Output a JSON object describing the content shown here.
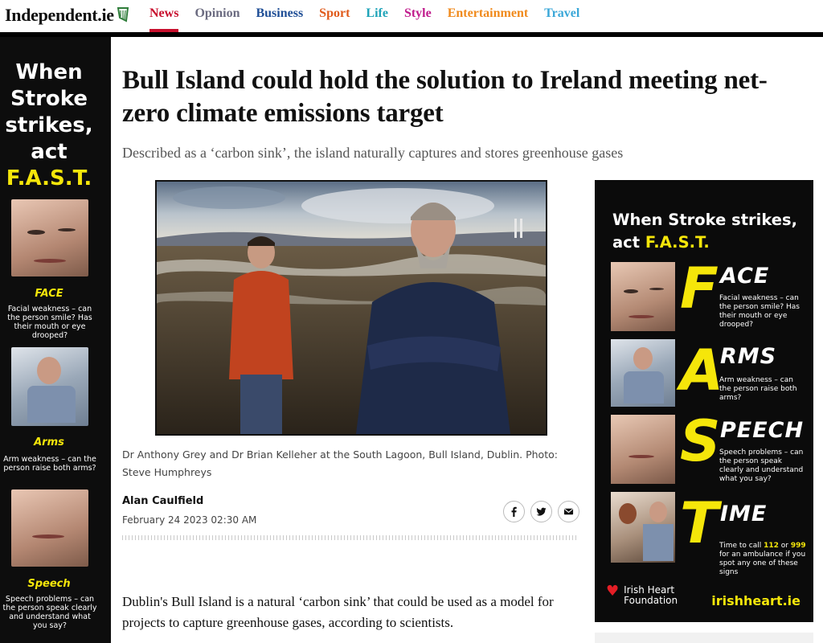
{
  "header": {
    "logo": "Independent.ie",
    "nav": [
      {
        "label": "News",
        "color": "#c8102e",
        "active": true
      },
      {
        "label": "Opinion",
        "color": "#6b6b80"
      },
      {
        "label": "Business",
        "color": "#1f4e96"
      },
      {
        "label": "Sport",
        "color": "#e05a1a"
      },
      {
        "label": "Life",
        "color": "#1ea3b8"
      },
      {
        "label": "Style",
        "color": "#c01a8c"
      },
      {
        "label": "Entertainment",
        "color": "#f08a1c"
      },
      {
        "label": "Travel",
        "color": "#3aa7d8"
      }
    ]
  },
  "left_ad": {
    "headline_white": "When Stroke strikes, act",
    "headline_yellow": "F.A.S.T.",
    "face_title": "FACE",
    "face_text": "Facial weakness – can the person smile? Has their mouth or eye drooped?",
    "arms_title": "Arms",
    "arms_text": "Arm weakness – can the person raise both arms?",
    "speech_title": "Speech",
    "speech_text": "Speech problems – can the person speak clearly and understand what you say?"
  },
  "article": {
    "headline": "Bull Island could hold the solution to Ireland meeting net-zero climate emissions target",
    "standfirst": "Described as a ‘carbon sink’, the island naturally captures and stores greenhouse gases",
    "caption": "Dr Anthony Grey and Dr Brian Kelleher at the South Lagoon, Bull Island, Dublin. Photo: Steve Humphreys",
    "author": "Alan Caulfield",
    "date": "February 24 2023 02:30 AM",
    "body_first_paragraph": "Dublin's Bull Island is a natural ‘carbon sink’ that could be used as a model for projects to capture greenhouse gases, according to scientists."
  },
  "share": {
    "icons": [
      "facebook-icon",
      "twitter-icon",
      "email-icon"
    ]
  },
  "right_ad": {
    "headline_white": "When Stroke strikes, act",
    "headline_yellow": "F.A.S.T.",
    "rows": [
      {
        "letter": "F",
        "word": "ACE",
        "text": "Facial weakness – can the person smile? Has their mouth or eye drooped?"
      },
      {
        "letter": "A",
        "word": "RMS",
        "text": "Arm weakness – can the person raise both arms?"
      },
      {
        "letter": "S",
        "word": "PEECH",
        "text": "Speech problems – can the person speak clearly and understand what you say?"
      },
      {
        "letter": "T",
        "word": "IME",
        "text_before": "Time to call ",
        "num1": "112",
        "or": " or ",
        "num2": "999",
        "text_after": " for an ambulance if you spot any one of these signs"
      }
    ],
    "org_line1": "Irish Heart",
    "org_line2": "Foundation",
    "url": "irishheart.ie"
  },
  "colors": {
    "brand_red": "#c8102e",
    "ad_yellow": "#f5e60a",
    "ad_black": "#0b0b0b"
  }
}
